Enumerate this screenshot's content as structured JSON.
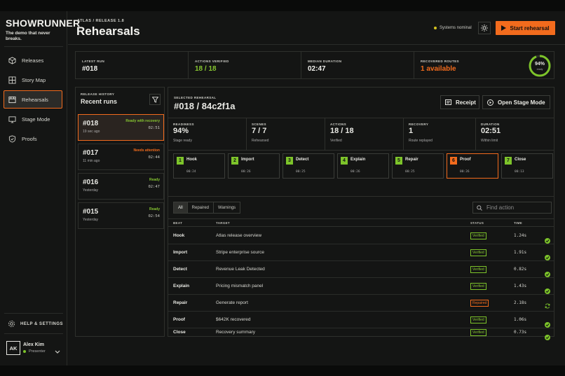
{
  "brand": {
    "name": "SHOWRUNNER",
    "tagline": "The demo that never breaks."
  },
  "nav": [
    {
      "label": "Releases",
      "icon": "box-icon"
    },
    {
      "label": "Story Map",
      "icon": "grid-icon"
    },
    {
      "label": "Rehearsals",
      "icon": "film-icon",
      "active": true
    },
    {
      "label": "Stage Mode",
      "icon": "monitor-icon"
    },
    {
      "label": "Proofs",
      "icon": "shield-check-icon"
    }
  ],
  "help_label": "HELP & SETTINGS",
  "user": {
    "initials": "AK",
    "name": "Alex Kim",
    "role": "Presenter"
  },
  "header": {
    "kicker": "ATLAS / RELEASE 1.8",
    "title": "Rehearsals",
    "status": "Systems nominal",
    "start_label": "Start rehearsal"
  },
  "stats": {
    "latest_run": {
      "label": "LATEST RUN",
      "value": "#018"
    },
    "actions_verified": {
      "label": "ACTIONS VERIFIED",
      "value": "18 / 18"
    },
    "median_duration": {
      "label": "MEDIAN DURATION",
      "value": "02:47"
    },
    "recovered_routes": {
      "label": "RECOVERED ROUTES",
      "value": "1 available"
    },
    "readiness_ring": {
      "value": "94%",
      "sub": "ready",
      "fraction": 0.94
    }
  },
  "history": {
    "kicker": "RELEASE HISTORY",
    "title": "Recent runs",
    "runs": [
      {
        "id": "#018",
        "time": "19 sec ago",
        "status": "Ready with recovery",
        "duration": "02:51",
        "selected": true
      },
      {
        "id": "#017",
        "time": "11 min ago",
        "status": "Needs attention",
        "duration": "02:44"
      },
      {
        "id": "#016",
        "time": "Yesterday",
        "status": "Ready",
        "duration": "02:47"
      },
      {
        "id": "#015",
        "time": "Yesterday",
        "status": "Ready",
        "duration": "02:54"
      }
    ]
  },
  "selected": {
    "kicker": "SELECTED REHEARSAL",
    "title": "#018 / 84c2f1a",
    "receipt_label": "Receipt",
    "stage_label": "Open Stage Mode",
    "metrics": [
      {
        "label": "READINESS",
        "value": "94%",
        "sub": "Stage ready"
      },
      {
        "label": "SCENES",
        "value": "7 / 7",
        "sub": "Rehearsed"
      },
      {
        "label": "ACTIONS",
        "value": "18 / 18",
        "sub": "Verified"
      },
      {
        "label": "RECOVERY",
        "value": "1",
        "sub": "Route replayed"
      },
      {
        "label": "DURATION",
        "value": "02:51",
        "sub": "Within limit"
      }
    ],
    "beats": [
      {
        "num": "1",
        "name": "Hook",
        "time": "00:24"
      },
      {
        "num": "2",
        "name": "Import",
        "time": "00:26"
      },
      {
        "num": "3",
        "name": "Detect",
        "time": "00:25"
      },
      {
        "num": "4",
        "name": "Explain",
        "time": "00:26"
      },
      {
        "num": "5",
        "name": "Repair",
        "time": "00:25"
      },
      {
        "num": "6",
        "name": "Proof",
        "time": "00:26",
        "selected": true
      },
      {
        "num": "7",
        "name": "Close",
        "time": "00:13"
      }
    ],
    "tabs": [
      "All",
      "Repaired",
      "Warnings"
    ],
    "search_placeholder": "Find action",
    "columns": [
      "BEAT",
      "TARGET",
      "STATUS",
      "TIME"
    ],
    "rows": [
      {
        "beat": "Hook",
        "target": "Atlas release overview",
        "status": "Verified",
        "time": "1.24s",
        "icon": "check-icon"
      },
      {
        "beat": "Import",
        "target": "Stripe enterprise source",
        "status": "Verified",
        "time": "1.91s",
        "icon": "check-icon"
      },
      {
        "beat": "Detect",
        "target": "Revenue Leak Detected",
        "status": "Verified",
        "time": "0.82s",
        "icon": "check-icon"
      },
      {
        "beat": "Explain",
        "target": "Pricing mismatch panel",
        "status": "Verified",
        "time": "1.43s",
        "icon": "check-icon"
      },
      {
        "beat": "Repair",
        "target": "Generate report",
        "status": "Repaired",
        "time": "2.18s",
        "icon": "refresh-icon"
      },
      {
        "beat": "Proof",
        "target": "$642K recovered",
        "status": "Verified",
        "time": "1.06s",
        "icon": "check-icon"
      },
      {
        "beat": "Close",
        "target": "Recovery summary",
        "status": "Verified",
        "time": "0.73s",
        "icon": "check-icon"
      }
    ]
  },
  "colors": {
    "accent": "#f26b1d",
    "success": "#7dc42a",
    "warning": "#d4c21e",
    "bg": "#141514"
  }
}
